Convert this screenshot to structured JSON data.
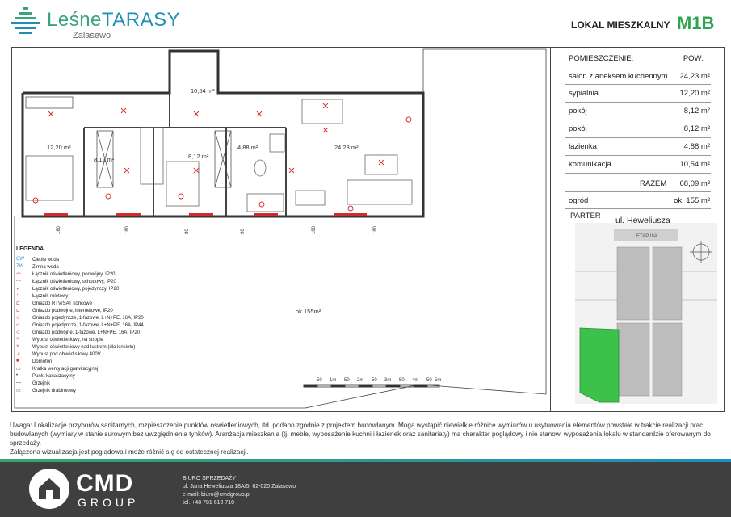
{
  "header": {
    "logo_part1": "Leśne",
    "logo_part2": "TARASY",
    "logo_sub": "Zalasewo",
    "lokal_label": "LOKAL MIESZKALNY",
    "lokal_code": "M1B"
  },
  "table": {
    "col_room": "POMIESZCZENIE:",
    "col_area": "POW:",
    "rooms": [
      {
        "name": "salon z aneksem kuchennym",
        "area": "24,23 m²"
      },
      {
        "name": "sypialnia",
        "area": "12,20 m²"
      },
      {
        "name": "pokój",
        "area": "8,12 m²"
      },
      {
        "name": "pokój",
        "area": "8,12 m²"
      },
      {
        "name": "łazienka",
        "area": "4,88 m²"
      },
      {
        "name": "komunikacja",
        "area": "10,54 m²"
      }
    ],
    "total_label": "RAZEM",
    "total_value": "68,09 m²",
    "garden_label": "ogród",
    "garden_value": "ok. 155 m²",
    "floor": "PARTER"
  },
  "site": {
    "street": "ul. Heweliusza",
    "etap": "ETAP IIIA"
  },
  "plan": {
    "room_labels": [
      "12,20 m²",
      "8,12 m²",
      "8,12 m²",
      "4,88 m²",
      "24,23 m²",
      "10,54 m²"
    ],
    "garden_area": "ok 155m²",
    "door_dims": [
      "180\n210",
      "180\n210",
      "80\n210",
      "90\n60",
      "180\n60",
      "180\n210"
    ],
    "side_dims": [
      "90\n210",
      "180\n210"
    ],
    "scale_labels": [
      "50",
      "1m",
      "50",
      "2m",
      "50",
      "3m",
      "50",
      "4m",
      "50",
      "5m"
    ]
  },
  "legend": {
    "title": "LEGENDA",
    "items": [
      "Ciepła woda",
      "Zimna woda",
      "Łącznik oświetleniowy, podwójny, IP20",
      "Łącznik oświetleniowy, schodowy, IP20",
      "Łącznik oświetleniowy, pojedynczy, IP20",
      "Łącznik roletowy",
      "Gniazdo RTV/SAT końcowe",
      "Gniazdo podwójne, internetowe, IP20",
      "Gniazdo pojedyncze, 1-fazowe, L+N+PE, 16A, IP20",
      "Gniazdo pojedyncze, 1-fazowe, L+N+PE, 16A, IP44",
      "Gniazdo podwójne, 1-fazowe, L+N+PE, 16A, IP20",
      "Wypust oświetleniowy, na stropie",
      "Wypust oświetleniowy nad lustrem (dla kinkietu)",
      "Wypust pod obwód siłowy 400V",
      "Domofon",
      "Kratka wentylacji grawitacyjnej",
      "Punkt kanalizacyjny",
      "Grzejnik",
      "Grzejnik drabinkowy"
    ]
  },
  "note": {
    "line1": "Uwaga: Lokalizacje przyborów sanitarnych, rozpieszczenie punktów oświetleniowych, itd. podano zgodnie z projektem budowlanym. Mogą wystąpić niewielkie różnice wymiarów u usytuowania elementów powstałe w trakcie realizacji prac budowlanych (wymiary w stanie surowym bez uwzględnienia tynków). Aranżacja mieszkania (tj. meble, wyposażenie kuchni i łazienek oraz sanitariaty) ma charakter poglądowy i nie stanowi wyposażenia lokalu w standardzie oferowanym do sprzedaży.",
    "line2": "Załączona wizualizacja jest poglądowa i może różnić się od ostatecznej realizacji."
  },
  "footer": {
    "brand": "CMD",
    "brand_sub": "GROUP",
    "office_title": "BIURO SPRZEDAŻY",
    "address": "ul. Jana Heweliusza 18A/5, 62-020 Zalasewo",
    "email": "e-mail: biuro@cmdgroup.pl",
    "phone": "tel. +48 781 610 710"
  },
  "colors": {
    "brand_green": "#2fa44f",
    "brand_blue": "#1f8fb4",
    "electric_red": "#d42a2a",
    "footer_bg": "#3f3f3f",
    "garden_green": "#3cc14a"
  }
}
